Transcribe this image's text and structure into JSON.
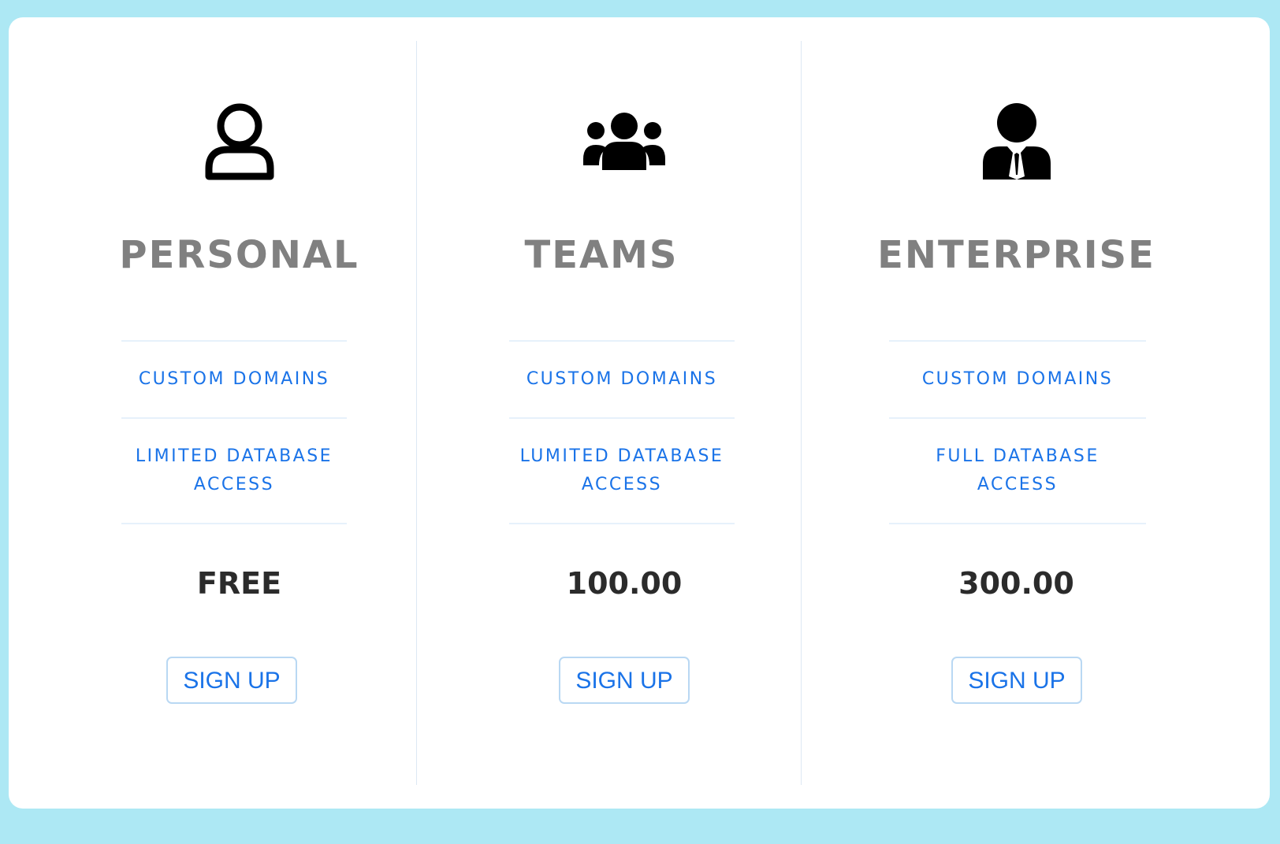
{
  "plans": [
    {
      "icon": "user-outline-icon",
      "title": "PERSONAL",
      "features": [
        {
          "label": "CUSTOM DOMAINS"
        },
        {
          "label": "LIMITED DATABASE\nACCESS"
        }
      ],
      "price": "FREE",
      "cta": "SIGN UP"
    },
    {
      "icon": "users-group-icon",
      "title": "TEAMS",
      "features": [
        {
          "label": "CUSTOM DOMAINS"
        },
        {
          "label": "LUMITED DATABASE\nACCESS"
        }
      ],
      "price": "100.00",
      "cta": "SIGN UP"
    },
    {
      "icon": "businessman-icon",
      "title": "ENTERPRISE",
      "features": [
        {
          "label": "CUSTOM DOMAINS"
        },
        {
          "label": "FULL DATABASE\nACCESS"
        }
      ],
      "price": "300.00",
      "cta": "SIGN UP"
    }
  ],
  "colors": {
    "page_background": "#ade8f4",
    "card_background": "#ffffff",
    "title": "#808080",
    "feature_text": "#1a73e8",
    "price": "#2b2b2b",
    "button_border": "#b9d8f3"
  }
}
